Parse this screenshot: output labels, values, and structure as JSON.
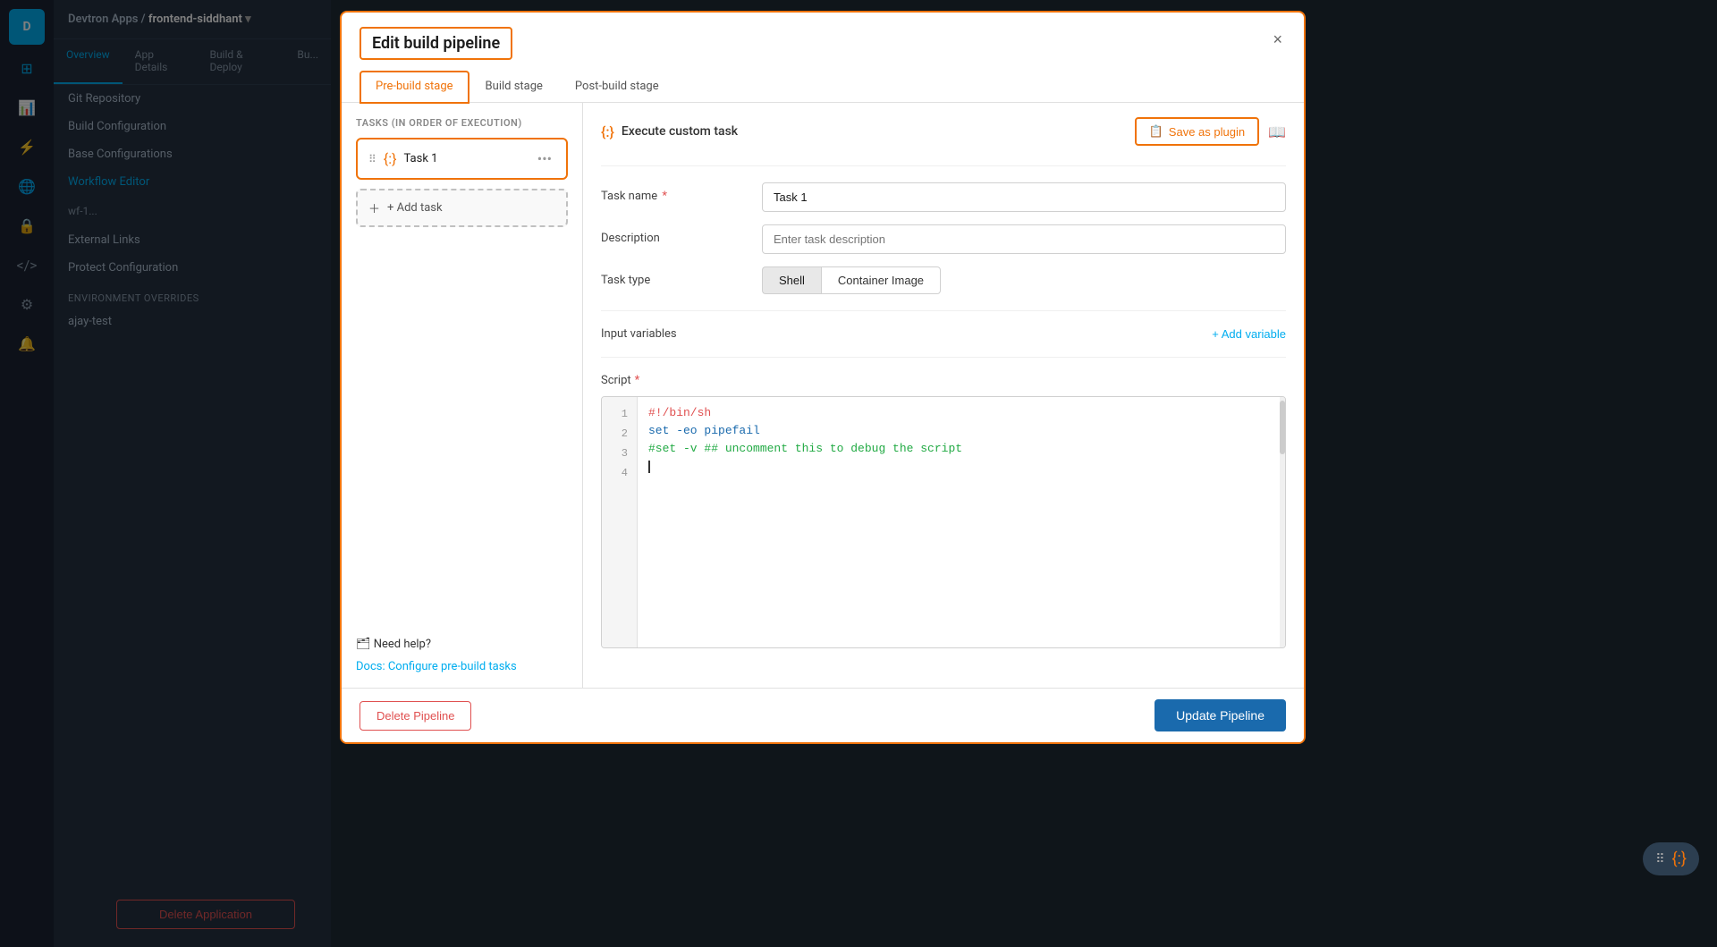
{
  "app": {
    "logo": "D",
    "breadcrumb": "Devtron Apps / frontend-siddhant"
  },
  "sidebar": {
    "nav_items": [
      "Overview",
      "App Details",
      "Build & Deploy",
      "Bu..."
    ],
    "sections": [
      {
        "label": null,
        "items": [
          "Git Repository",
          "Build Configuration",
          "Base Configurations"
        ]
      },
      {
        "label": "ENVIRONMENT OVERRIDES",
        "items": [
          "ajay-test"
        ]
      },
      {
        "label": null,
        "items": [
          "External Links",
          "Protect Configuration"
        ]
      }
    ],
    "active_item": "Workflow Editor",
    "workflow_label": "wf-1...",
    "delete_btn": "Delete Application"
  },
  "modal": {
    "title": "Edit build pipeline",
    "close_label": "×",
    "tabs": [
      {
        "label": "Pre-build stage",
        "active": true
      },
      {
        "label": "Build stage",
        "active": false
      },
      {
        "label": "Post-build stage",
        "active": false
      }
    ],
    "left_panel": {
      "tasks_label": "TASKS (IN ORDER OF EXECUTION)",
      "task": {
        "name": "Task 1",
        "icon": "{:}"
      },
      "add_task_label": "+ Add task",
      "help": {
        "title": "🗂 Need help?",
        "link_label": "Docs: Configure pre-build tasks"
      }
    },
    "right_panel": {
      "header": {
        "title": "Execute custom task",
        "save_plugin_label": "Save as plugin",
        "save_plugin_icon": "📋"
      },
      "form": {
        "task_name_label": "Task name",
        "task_name_required": true,
        "task_name_value": "Task 1",
        "description_label": "Description",
        "description_placeholder": "Enter task description",
        "task_type_label": "Task type",
        "task_type_options": [
          "Shell",
          "Container Image"
        ],
        "task_type_active": "Shell",
        "input_variables_label": "Input variables",
        "add_variable_label": "+ Add variable",
        "script_label": "Script",
        "script_required": true
      },
      "code": {
        "lines": [
          {
            "num": "1",
            "content": "#!/bin/sh",
            "type": "shebang"
          },
          {
            "num": "2",
            "content": "set -eo pipefail",
            "type": "cmd"
          },
          {
            "num": "3",
            "content": "#set -v ## uncomment this to debug the script",
            "type": "comment"
          },
          {
            "num": "4",
            "content": "",
            "type": "cursor"
          }
        ]
      }
    },
    "footer": {
      "delete_label": "Delete Pipeline",
      "update_label": "Update Pipeline"
    }
  },
  "floating_badge": {
    "dots": "⠿",
    "icon": "{:}"
  },
  "icons": {
    "sidebar_apps": "⊞",
    "sidebar_chart": "📊",
    "sidebar_deploy": "🚀",
    "sidebar_env": "🌐",
    "sidebar_settings": "⚙",
    "sidebar_security": "🔒",
    "sidebar_code": "</>",
    "sidebar_config": "⚙",
    "sidebar_notif": "🔔",
    "save_plugin_icon": "📋",
    "docs_icon": "📖",
    "execute_icon": "{:}"
  }
}
